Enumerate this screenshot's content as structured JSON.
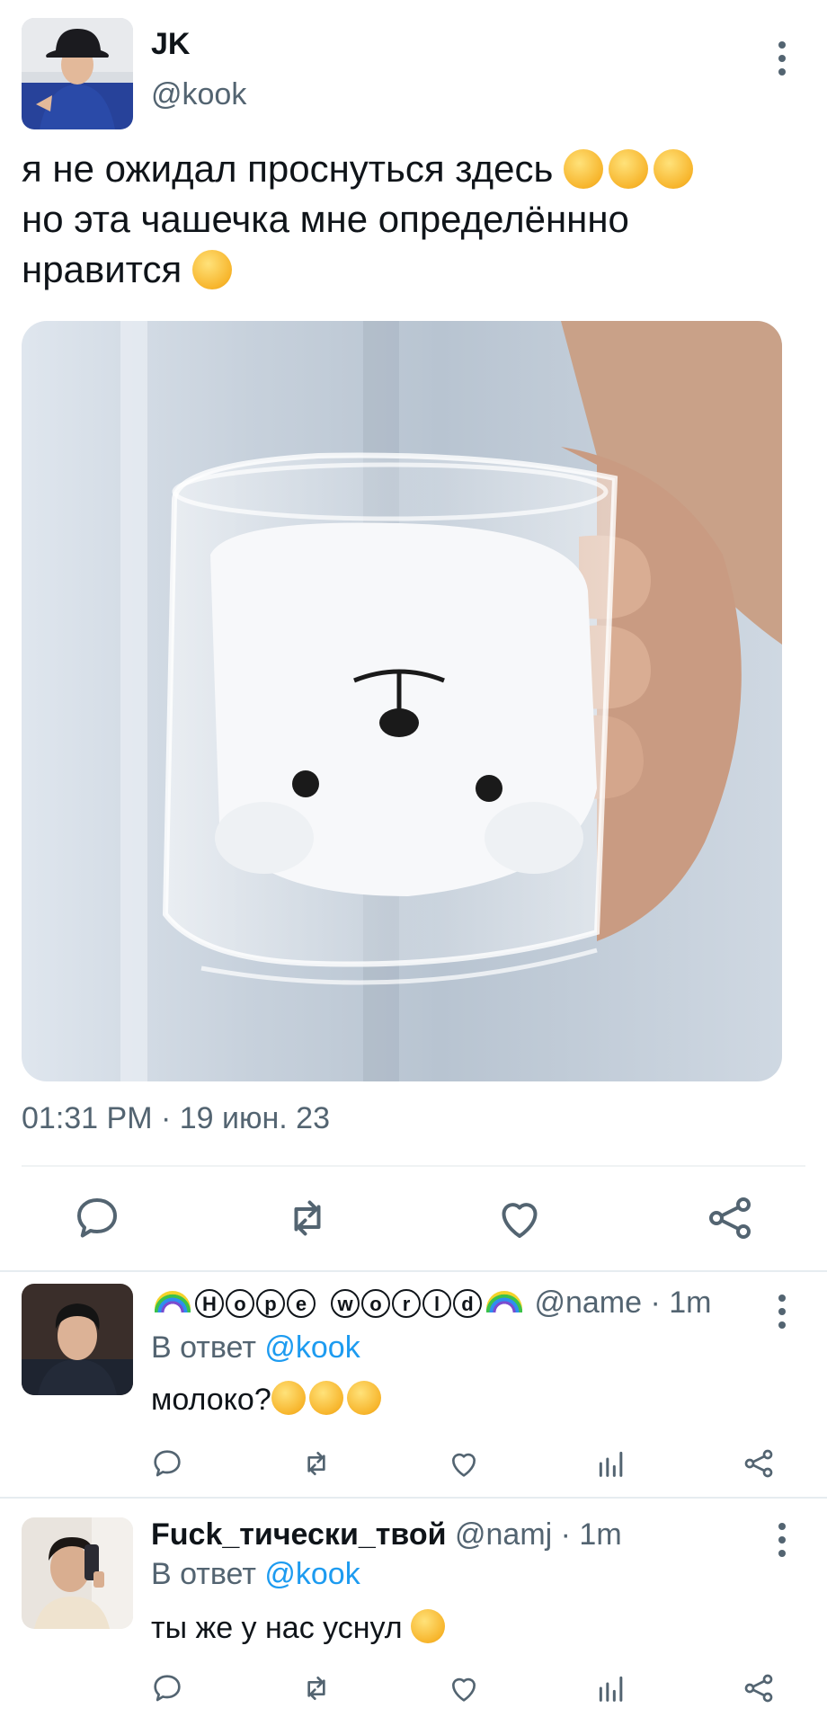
{
  "main_tweet": {
    "display_name": "JK",
    "handle": "@kook",
    "text_line1": "я не ожидал проснуться здесь",
    "text_line2": "но эта чашечка мне определённно",
    "text_line3": "нравится",
    "timestamp": "01:31 PM · 19 июн. 23"
  },
  "replies": [
    {
      "name_letters": [
        "H",
        "o",
        "p",
        "e",
        "w",
        "o",
        "r",
        "l",
        "d"
      ],
      "handle": "@name",
      "time": "· 1m",
      "reply_prefix": "В ответ",
      "reply_mention": "@kook",
      "text": "молоко?"
    },
    {
      "display_name": "Fuck_тически_твой",
      "handle": "@namj",
      "time": "· 1m",
      "reply_prefix": "В ответ",
      "reply_mention": "@kook",
      "text": "ты же у нас уснул"
    }
  ],
  "colors": {
    "text": "#0f1419",
    "secondary": "#536471",
    "link": "#1d9bf0",
    "divider": "#eff3f4"
  },
  "icons": [
    "more-icon",
    "reply-icon",
    "retweet-icon",
    "like-icon",
    "share-icon",
    "analytics-icon",
    "smiling-face-with-hearts-emoji",
    "halo-face-emoji",
    "rofl-emoji",
    "surprised-face-emoji",
    "rainbow-emoji"
  ]
}
